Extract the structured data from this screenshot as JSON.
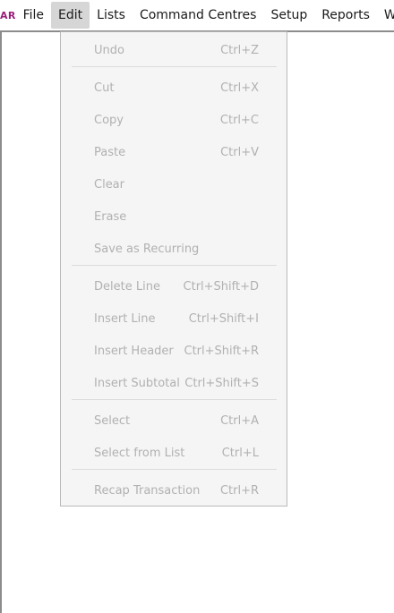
{
  "app_logo": "AR",
  "menubar": {
    "items": [
      "File",
      "Edit",
      "Lists",
      "Command Centres",
      "Setup",
      "Reports",
      "W"
    ]
  },
  "edit_menu": {
    "items": [
      {
        "label": "Undo",
        "shortcut": "Ctrl+Z",
        "enabled": false
      },
      {
        "label": "Cut",
        "shortcut": "Ctrl+X",
        "enabled": false
      },
      {
        "label": "Copy",
        "shortcut": "Ctrl+C",
        "enabled": false
      },
      {
        "label": "Paste",
        "shortcut": "Ctrl+V",
        "enabled": false
      },
      {
        "label": "Clear",
        "shortcut": "",
        "enabled": false
      },
      {
        "label": "Erase",
        "shortcut": "",
        "enabled": false
      },
      {
        "label": "Save as Recurring",
        "shortcut": "",
        "enabled": false
      },
      {
        "label": "Delete Line",
        "shortcut": "Ctrl+Shift+D",
        "enabled": false
      },
      {
        "label": "Insert Line",
        "shortcut": "Ctrl+Shift+I",
        "enabled": false
      },
      {
        "label": "Insert Header",
        "shortcut": "Ctrl+Shift+R",
        "enabled": false
      },
      {
        "label": "Insert Subtotal",
        "shortcut": "Ctrl+Shift+S",
        "enabled": false
      },
      {
        "label": "Select",
        "shortcut": "Ctrl+A",
        "enabled": false
      },
      {
        "label": "Select from List",
        "shortcut": "Ctrl+L",
        "enabled": false
      },
      {
        "label": "Recap Transaction",
        "shortcut": "Ctrl+R",
        "enabled": false
      }
    ]
  },
  "colors": {
    "logo": "#9a1f7a",
    "disabled_text": "#b1b1b1",
    "menu_background": "#f5f5f5",
    "active_menu_highlight": "#d6d6d6"
  }
}
